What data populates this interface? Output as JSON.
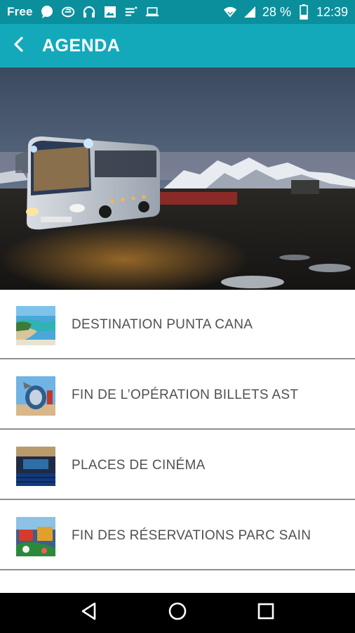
{
  "status_bar": {
    "carrier": "Free",
    "battery_percent": "28 %",
    "time": "12:39",
    "icons": [
      "chat-bubble-icon",
      "e-logo-icon",
      "headset-icon",
      "image-icon",
      "notes-icon",
      "laptop-icon"
    ]
  },
  "app_bar": {
    "title": "AGENDA",
    "back_icon": "chevron-left-icon"
  },
  "colors": {
    "status_bar": "#0b8f9c",
    "app_bar": "#13a9bb",
    "text": "#505050",
    "divider": "#8f8f8f"
  },
  "hero": {
    "description_icon": "bus-landscape-image"
  },
  "agenda": {
    "items": [
      {
        "label": "DESTINATION PUNTA CANA",
        "thumb": "beach-thumbnail"
      },
      {
        "label": "FIN DE L’OPÉRATION BILLETS AST",
        "thumb": "sculpture-thumbnail"
      },
      {
        "label": "PLACES DE CINÉMA",
        "thumb": "cinema-thumbnail"
      },
      {
        "label": "FIN DES RÉSERVATIONS PARC SAIN",
        "thumb": "amusement-park-thumbnail"
      },
      {
        "label": "",
        "thumb": "partial-thumbnail"
      }
    ]
  },
  "nav_bar": {
    "back": "triangle-back-icon",
    "home": "circle-home-icon",
    "recents": "square-recents-icon"
  }
}
